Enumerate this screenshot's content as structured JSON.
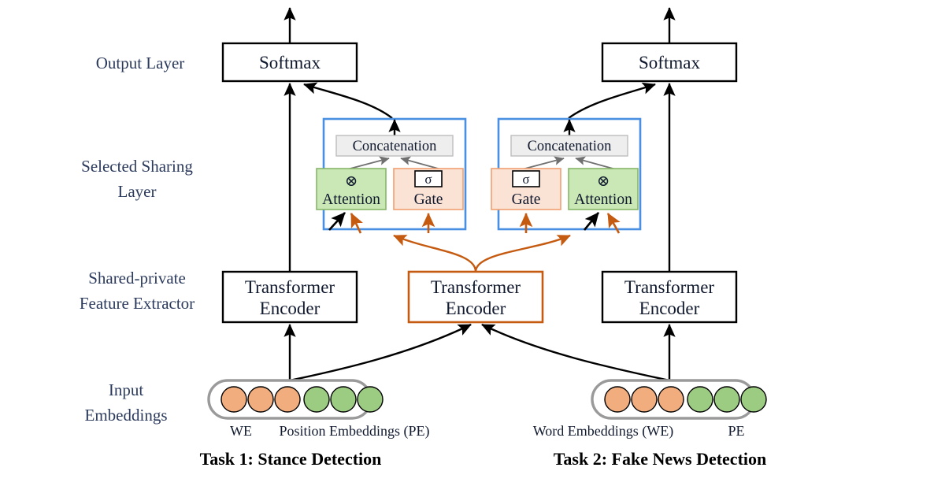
{
  "figure": {
    "title": "Multi-task shared-private transformer architecture with selected sharing layer",
    "colors": {
      "black": "#000000",
      "orange_accent": "#c55a11",
      "blue_block": "#4a90e2",
      "green_fill": "#cae8b5",
      "green_border": "#86b66a",
      "peach_fill": "#fae2d5",
      "peach_border": "#f0a070",
      "gray_fill": "#eeeeee",
      "gray_border": "#bdbdbd",
      "pill_border": "#9a9a9a",
      "circle_orange": "#f2ad7e",
      "circle_green": "#9ccb82",
      "text_navy": "#1f3050"
    }
  },
  "row_labels": [
    {
      "id": "output-layer",
      "lines": [
        "Output Layer"
      ]
    },
    {
      "id": "selected-sharing-layer",
      "lines": [
        "Selected  Sharing",
        "Layer"
      ]
    },
    {
      "id": "shared-private-feature-extractor",
      "lines": [
        "Shared-private",
        "Feature Extractor"
      ]
    },
    {
      "id": "input-embeddings",
      "lines": [
        "Input",
        "Embeddings"
      ]
    }
  ],
  "output_layer": {
    "left_softmax": "Softmax",
    "right_softmax": "Softmax"
  },
  "sharing_layer": {
    "left": {
      "concatenation": "Concatenation",
      "first_unit": {
        "type": "attention",
        "label": "Attention",
        "symbol": "⊗"
      },
      "second_unit": {
        "type": "gate",
        "label": "Gate",
        "symbol": "σ"
      }
    },
    "right": {
      "concatenation": "Concatenation",
      "first_unit": {
        "type": "gate",
        "label": "Gate",
        "symbol": "σ"
      },
      "second_unit": {
        "type": "attention",
        "label": "Attention",
        "symbol": "⊗"
      }
    }
  },
  "feature_extractor": {
    "left_encoder": [
      "Transformer",
      "Encoder"
    ],
    "shared_encoder": [
      "Transformer",
      "Encoder"
    ],
    "right_encoder": [
      "Transformer",
      "Encoder"
    ]
  },
  "embeddings": {
    "left": {
      "word_count": 3,
      "position_count": 3,
      "left_caption": "WE",
      "right_caption": "Position Embeddings (PE)"
    },
    "right": {
      "word_count": 3,
      "position_count": 3,
      "left_caption": "Word Embeddings (WE)",
      "right_caption": "PE"
    }
  },
  "captions": {
    "task1": "Task 1: Stance Detection",
    "task2": "Task 2: Fake News Detection"
  }
}
